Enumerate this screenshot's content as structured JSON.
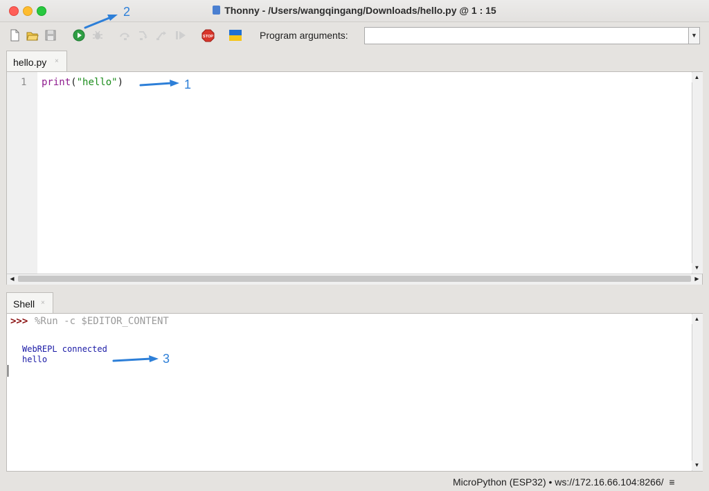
{
  "window": {
    "title": "Thonny  -  /Users/wangqingang/Downloads/hello.py  @  1 : 15"
  },
  "toolbar": {
    "buttons": [
      "new-file-icon",
      "open-file-icon",
      "save-icon",
      "run-icon",
      "debug-icon",
      "step-over-icon",
      "step-into-icon",
      "step-out-icon",
      "resume-icon",
      "stop-icon",
      "ukraine-flag-icon"
    ],
    "program_arguments_label": "Program arguments:",
    "program_arguments_value": ""
  },
  "editor": {
    "tab_label": "hello.py",
    "tab_close": "×",
    "line_number": "1",
    "code": {
      "fn": "print",
      "open": "(",
      "str": "\"hello\"",
      "close": ")"
    }
  },
  "shell": {
    "tab_label": "Shell",
    "tab_close": "×",
    "prompt": ">>>",
    "command": "%Run -c $EDITOR_CONTENT",
    "output": [
      "WebREPL connected",
      "hello"
    ]
  },
  "status_bar": {
    "text": "MicroPython (ESP32)  •  ws://172.16.66.104:8266/",
    "menu_icon": "≡"
  },
  "annotations": [
    "1",
    "2",
    "3"
  ],
  "colors": {
    "annotation": "#2d7fd8",
    "prompt": "#8b1111",
    "output": "#1a1aa6"
  }
}
